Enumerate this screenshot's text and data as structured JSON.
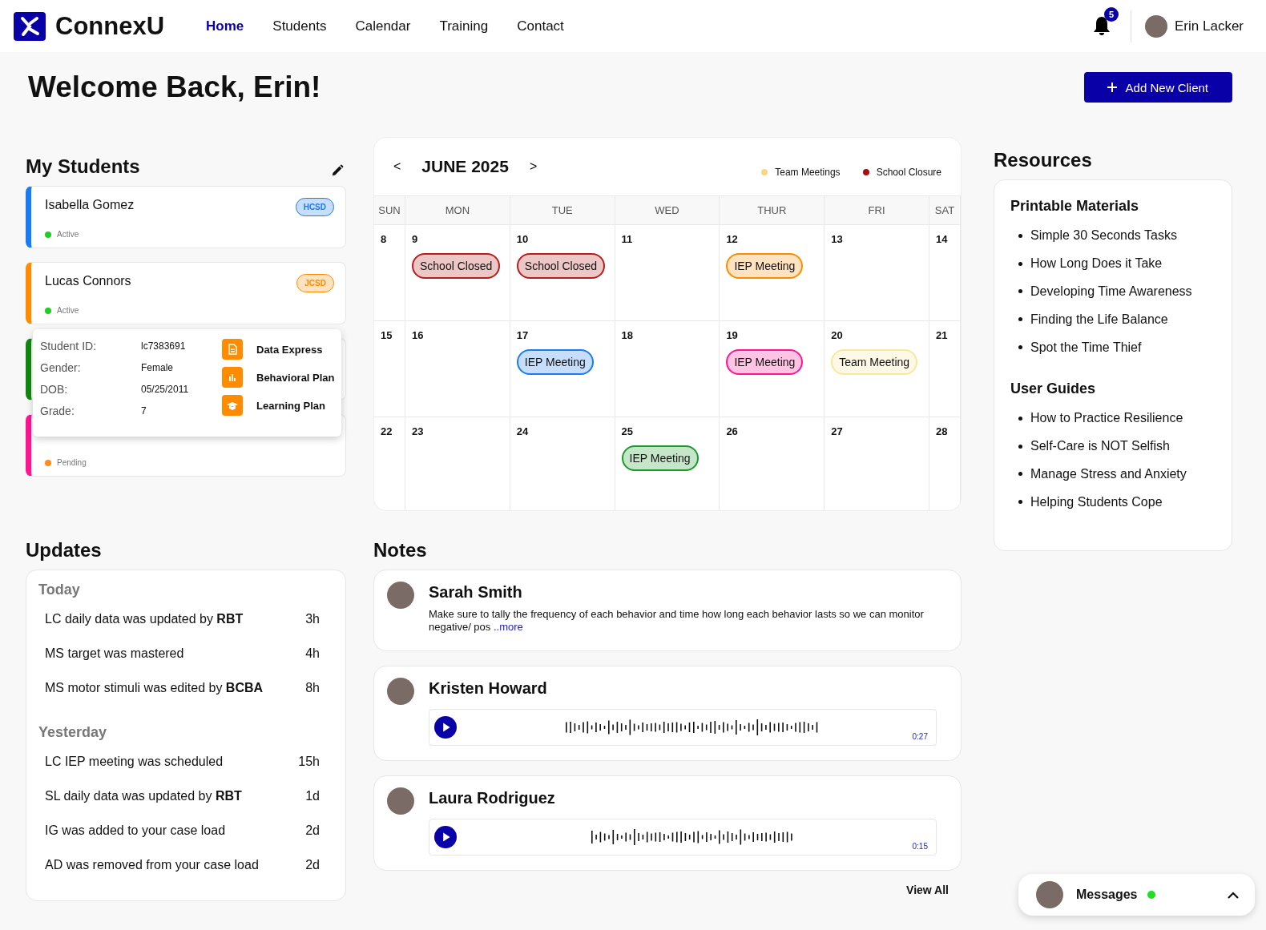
{
  "brand": {
    "name": "ConnexU"
  },
  "nav": [
    {
      "label": "Home",
      "selected": true
    },
    {
      "label": "Students",
      "selected": false
    },
    {
      "label": "Calendar",
      "selected": false
    },
    {
      "label": "Training",
      "selected": false
    },
    {
      "label": "Contact",
      "selected": false
    }
  ],
  "notifications": {
    "count": "5"
  },
  "user": {
    "name": "Erin Lacker"
  },
  "welcome": "Welcome Back, Erin!",
  "add_button": "Add New Client",
  "students": {
    "title": "My Students",
    "items": [
      {
        "name": "Isabella Gomez",
        "district": "HCSD",
        "status": {
          "label": "Active",
          "color": "#22cc22"
        },
        "color": "#1a7cf0"
      },
      {
        "name": "Lucas Connors",
        "district": "JCSD",
        "status": {
          "label": "Active",
          "color": "#22cc22"
        },
        "color": "#ff8c00"
      },
      {
        "color": "#118811"
      },
      {
        "status": {
          "label": "Pending",
          "color": "#ff8c1a"
        },
        "color": "#ff1493"
      }
    ],
    "popover": {
      "details": [
        {
          "label": "Student ID:",
          "value": "lc7383691"
        },
        {
          "label": "Gender:",
          "value": "Female"
        },
        {
          "label": "DOB:",
          "value": "05/25/2011"
        },
        {
          "label": "Grade:",
          "value": "7"
        }
      ],
      "actions": [
        {
          "kind": "document",
          "label": "Data Express"
        },
        {
          "kind": "chart",
          "label": "Behavioral Plan"
        },
        {
          "kind": "cap",
          "label": "Learning Plan"
        }
      ]
    }
  },
  "calendar": {
    "month": "JUNE 2025",
    "prev": "<",
    "next": ">",
    "legend": [
      {
        "label": "Team Meetings",
        "color": "#f9d77e"
      },
      {
        "label": "School Closure",
        "color": "#a50f0f"
      }
    ],
    "weekdays": [
      "SUN",
      "MON",
      "TUE",
      "WED",
      "THUR",
      "FRI",
      "SAT"
    ],
    "weeks": [
      [
        {
          "day": "8"
        },
        {
          "day": "9",
          "events": [
            {
              "label": "School Closed",
              "color": "#b81c1c"
            }
          ]
        },
        {
          "day": "10",
          "events": [
            {
              "label": "School Closed",
              "color": "#b81c1c"
            }
          ]
        },
        {
          "day": "11"
        },
        {
          "day": "12",
          "events": [
            {
              "label": "IEP Meeting",
              "color": "#ff8c00"
            }
          ]
        },
        {
          "day": "13"
        },
        {
          "day": "14"
        }
      ],
      [
        {
          "day": "15"
        },
        {
          "day": "16"
        },
        {
          "day": "17",
          "events": [
            {
              "label": "IEP Meeting",
              "color": "#1a7cf0"
            }
          ]
        },
        {
          "day": "18"
        },
        {
          "day": "19",
          "events": [
            {
              "label": "IEP Meeting",
              "color": "#ff1493"
            }
          ]
        },
        {
          "day": "20",
          "events": [
            {
              "label": "Team Meeting",
              "color": "#f9e89a"
            }
          ]
        },
        {
          "day": "21"
        }
      ],
      [
        {
          "day": "22"
        },
        {
          "day": "23"
        },
        {
          "day": "24"
        },
        {
          "day": "25",
          "events": [
            {
              "label": "IEP Meeting",
              "color": "#1a9a2a"
            }
          ]
        },
        {
          "day": "26"
        },
        {
          "day": "27"
        },
        {
          "day": "28"
        }
      ]
    ]
  },
  "resources": {
    "title": "Resources",
    "groups": [
      {
        "title": "Printable Materials",
        "items": [
          "Simple 30 Seconds Tasks",
          "How Long Does it Take",
          "Developing Time Awareness",
          "Finding the Life Balance",
          "Spot the Time Thief"
        ]
      },
      {
        "title": "User Guides",
        "items": [
          "How to Practice Resilience",
          "Self-Care is NOT Selfish",
          "Manage Stress and Anxiety",
          "Helping Students Cope"
        ]
      }
    ]
  },
  "updates": {
    "title": "Updates",
    "groups": [
      {
        "title": "Today",
        "items": [
          {
            "text": "LC daily data was updated by **RBT**",
            "time": "3h"
          },
          {
            "text": "MS target was mastered",
            "time": "4h"
          },
          {
            "text": "MS motor stimuli was edited by **BCBA**",
            "time": "8h"
          }
        ]
      },
      {
        "title": "Yesterday",
        "items": [
          {
            "text": "LC IEP meeting was scheduled",
            "time": "15h"
          },
          {
            "text": "SL daily data was updated by **RBT**",
            "time": "1d"
          },
          {
            "text": "IG was added to your case load",
            "time": "2d"
          },
          {
            "text": "AD was removed from your case load",
            "time": "2d"
          }
        ]
      }
    ]
  },
  "notes": {
    "title": "Notes",
    "items": [
      {
        "kind": "text",
        "author": "Sarah Smith",
        "text": "Make sure to tally the frequency of each behavior and time how long each behavior lasts so we can monitor negative/ pos",
        "more": "..more"
      },
      {
        "kind": "audio",
        "author": "Kristen Howard",
        "duration": "0:27"
      },
      {
        "kind": "audio",
        "author": "Laura Rodriguez",
        "duration": "0:15"
      }
    ],
    "view_all": "View All"
  },
  "messages": {
    "label": "Messages",
    "online": true
  }
}
